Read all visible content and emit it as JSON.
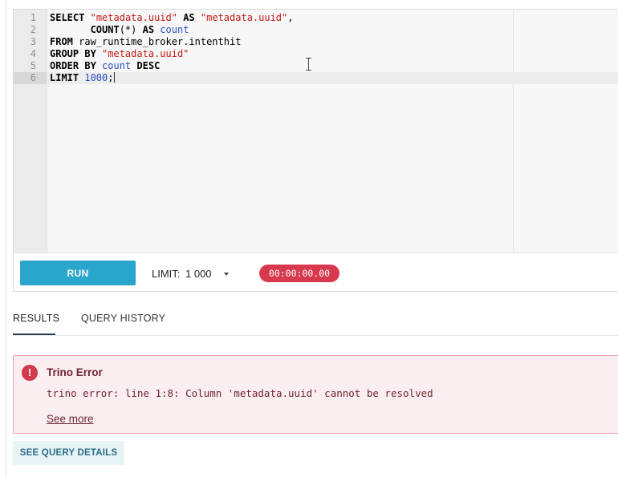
{
  "editor": {
    "lines": [
      {
        "num": "1",
        "tokens": [
          {
            "t": "SELECT",
            "c": "kw"
          },
          {
            "t": " ",
            "c": ""
          },
          {
            "t": "\"metadata.uuid\"",
            "c": "str"
          },
          {
            "t": " ",
            "c": ""
          },
          {
            "t": "AS",
            "c": "kw"
          },
          {
            "t": " ",
            "c": ""
          },
          {
            "t": "\"metadata.uuid\"",
            "c": "str"
          },
          {
            "t": ",",
            "c": ""
          }
        ]
      },
      {
        "num": "2",
        "tokens": [
          {
            "t": "       ",
            "c": ""
          },
          {
            "t": "COUNT",
            "c": "kw"
          },
          {
            "t": "(*) ",
            "c": ""
          },
          {
            "t": "AS",
            "c": "kw"
          },
          {
            "t": " ",
            "c": ""
          },
          {
            "t": "count",
            "c": "id"
          }
        ]
      },
      {
        "num": "3",
        "tokens": [
          {
            "t": "FROM",
            "c": "kw"
          },
          {
            "t": " raw_runtime_broker.intenthit",
            "c": ""
          }
        ]
      },
      {
        "num": "4",
        "tokens": [
          {
            "t": "GROUP BY",
            "c": "kw"
          },
          {
            "t": " ",
            "c": ""
          },
          {
            "t": "\"metadata.uuid\"",
            "c": "str"
          }
        ]
      },
      {
        "num": "5",
        "tokens": [
          {
            "t": "ORDER BY",
            "c": "kw"
          },
          {
            "t": " ",
            "c": ""
          },
          {
            "t": "count",
            "c": "id"
          },
          {
            "t": " ",
            "c": ""
          },
          {
            "t": "DESC",
            "c": "kw"
          }
        ]
      },
      {
        "num": "6",
        "tokens": [
          {
            "t": "LIMIT",
            "c": "kw"
          },
          {
            "t": " ",
            "c": ""
          },
          {
            "t": "1000",
            "c": "num"
          },
          {
            "t": ";",
            "c": ""
          }
        ],
        "active": true
      }
    ]
  },
  "toolbar": {
    "run_label": "RUN",
    "limit_label": "LIMIT:",
    "limit_value": "1 000",
    "timer": "00:00:00.00"
  },
  "tabs": [
    {
      "label": "RESULTS",
      "active": true
    },
    {
      "label": "QUERY HISTORY",
      "active": false
    }
  ],
  "error": {
    "icon": "!",
    "title": "Trino Error",
    "message": "trino error: line 1:8: Column 'metadata.uuid' cannot be resolved",
    "see_more": "See more"
  },
  "details_label": "SEE QUERY DETAILS",
  "colors": {
    "run": "#2aa6cc",
    "timer": "#d9394f",
    "error_bg": "#fbeef0",
    "error_border": "#e9a3ad"
  }
}
